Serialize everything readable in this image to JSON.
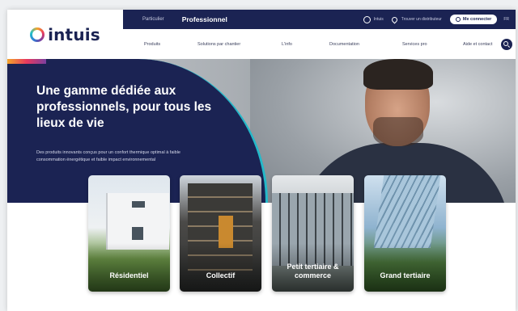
{
  "brand": {
    "logo_text": "intuis"
  },
  "topbar": {
    "segment_particulier": "Particulier",
    "segment_professionnel": "Professionnel",
    "intuis_link": "Intuis",
    "distributor_link": "Trouver un distributeur",
    "connect_button": "Me connecter",
    "language": "FR"
  },
  "navbar": {
    "items": [
      {
        "label": "Produits"
      },
      {
        "label": "Solutions par chantier"
      },
      {
        "label": "L'info"
      },
      {
        "label": "Documentation"
      },
      {
        "label": "Services pro"
      },
      {
        "label": "Aide et contact"
      }
    ],
    "search_icon": "search-icon"
  },
  "hero": {
    "title": "Une gamme dédiée aux professionnels, pour tous les lieux de vie",
    "subtitle": "Des produits innovants conçus pour un confort thermique optimal à faible consommation énergétique et faible impact environnemental"
  },
  "cards": [
    {
      "label": "Résidentiel"
    },
    {
      "label": "Collectif"
    },
    {
      "label": "Petit tertiaire & commerce"
    },
    {
      "label": "Grand tertiaire"
    }
  ],
  "colors": {
    "navy": "#1b2353",
    "accent_teal": "#24b9c9",
    "white": "#ffffff"
  }
}
